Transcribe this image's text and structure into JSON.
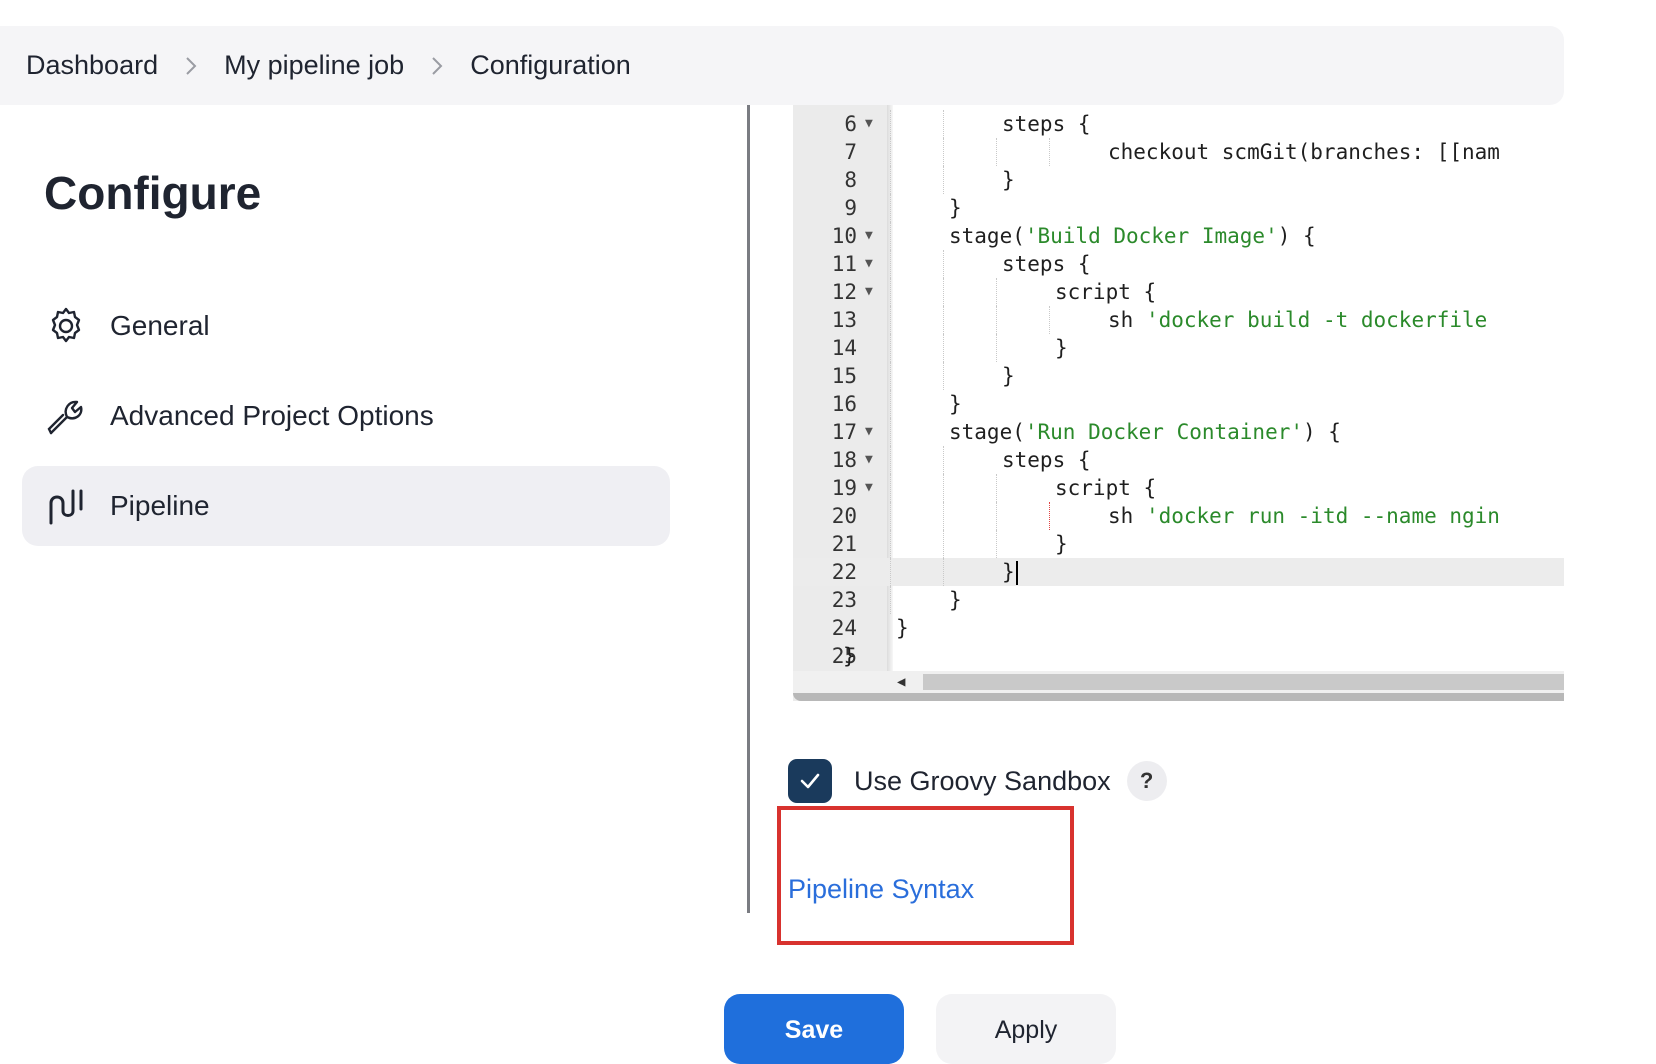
{
  "breadcrumb": {
    "items": [
      "Dashboard",
      "My pipeline job",
      "Configuration"
    ]
  },
  "sidebar": {
    "title": "Configure",
    "items": [
      {
        "label": "General",
        "icon": "gear-icon"
      },
      {
        "label": "Advanced Project Options",
        "icon": "wrench-icon"
      },
      {
        "label": "Pipeline",
        "icon": "pipeline-icon",
        "active": true
      }
    ]
  },
  "editor": {
    "lines": [
      {
        "n": "6",
        "fold": true,
        "text": "steps {"
      },
      {
        "n": "7",
        "fold": false,
        "text": "checkout scmGit(branches: [[nam"
      },
      {
        "n": "8",
        "fold": false,
        "text": "}"
      },
      {
        "n": "9",
        "fold": false,
        "text": "}"
      },
      {
        "n": "10",
        "fold": true,
        "text": "stage(",
        "str": "'Build Docker Image'",
        "tail": ") {"
      },
      {
        "n": "11",
        "fold": true,
        "text": "steps {"
      },
      {
        "n": "12",
        "fold": true,
        "text": "script {"
      },
      {
        "n": "13",
        "fold": false,
        "text": "sh ",
        "str": "'docker build -t dockerfile"
      },
      {
        "n": "14",
        "fold": false,
        "text": "}"
      },
      {
        "n": "15",
        "fold": false,
        "text": "}"
      },
      {
        "n": "16",
        "fold": false,
        "text": "}"
      },
      {
        "n": "17",
        "fold": true,
        "text": "stage(",
        "str": "'Run Docker Container'",
        "tail": ") {"
      },
      {
        "n": "18",
        "fold": true,
        "text": "steps {"
      },
      {
        "n": "19",
        "fold": true,
        "text": "script {"
      },
      {
        "n": "20",
        "fold": false,
        "text": "sh ",
        "str": "'docker run -itd --name ngin"
      },
      {
        "n": "21",
        "fold": false,
        "text": "}"
      },
      {
        "n": "22",
        "fold": false,
        "text": "}",
        "current": true
      },
      {
        "n": "23",
        "fold": false,
        "text": "}"
      },
      {
        "n": "24",
        "fold": false,
        "text": "}"
      },
      {
        "n": "25",
        "fold": false,
        "text": "}"
      }
    ]
  },
  "sandbox": {
    "label": "Use Groovy Sandbox",
    "checked": true,
    "help": "?"
  },
  "links": {
    "pipeline_syntax": "Pipeline Syntax"
  },
  "buttons": {
    "save": "Save",
    "apply": "Apply"
  },
  "colors": {
    "primary": "#1f6fdc",
    "checkbox": "#1a3a5c",
    "link": "#2a6edb",
    "highlight": "#d8322e",
    "string": "#2b8a2b"
  }
}
